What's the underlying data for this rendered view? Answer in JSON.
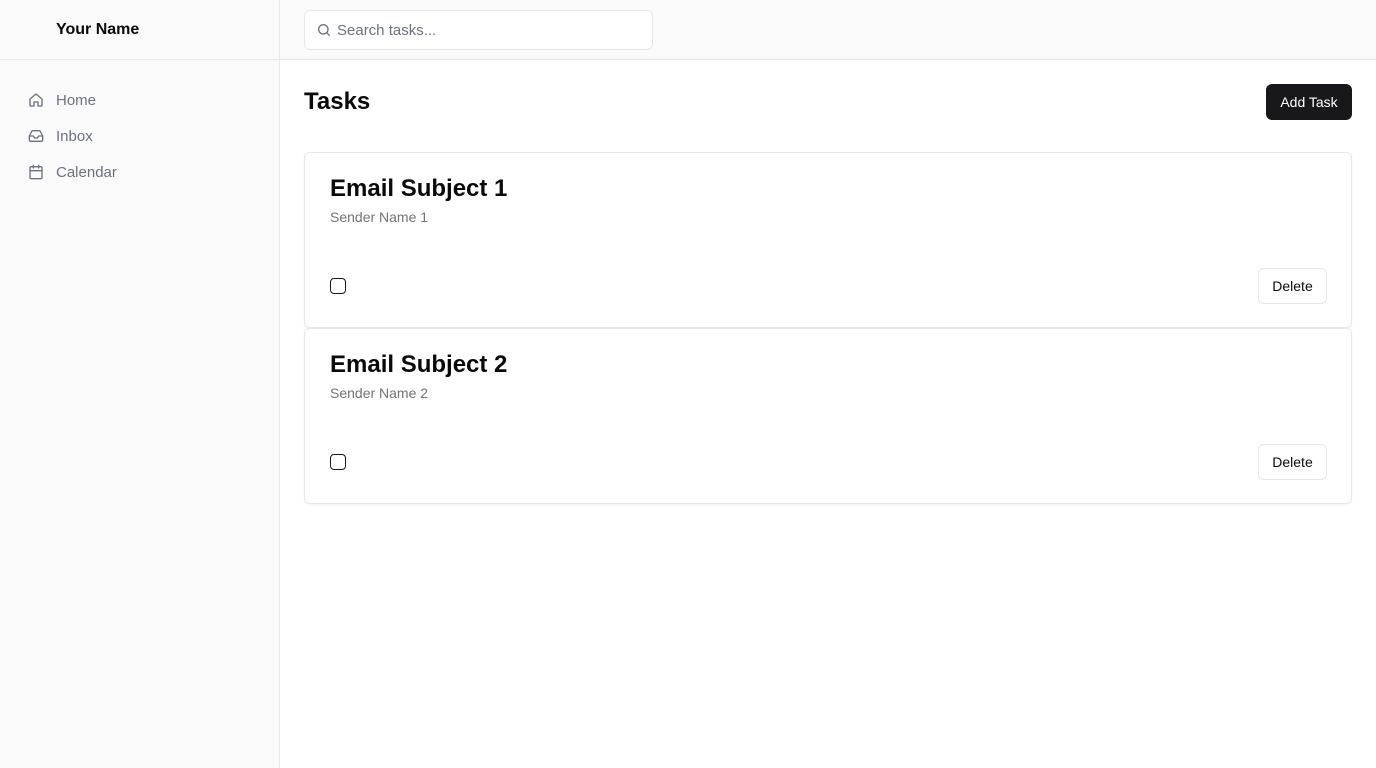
{
  "sidebar": {
    "user_name": "Your Name",
    "items": [
      {
        "label": "Home",
        "icon": "home-icon"
      },
      {
        "label": "Inbox",
        "icon": "inbox-icon"
      },
      {
        "label": "Calendar",
        "icon": "calendar-icon"
      }
    ]
  },
  "search": {
    "placeholder": "Search tasks...",
    "value": "",
    "icon": "search-icon"
  },
  "main": {
    "title": "Tasks",
    "add_button_label": "Add Task",
    "tasks": [
      {
        "subject": "Email Subject 1",
        "sender": "Sender Name 1",
        "checked": false,
        "delete_label": "Delete"
      },
      {
        "subject": "Email Subject 2",
        "sender": "Sender Name 2",
        "checked": false,
        "delete_label": "Delete"
      }
    ]
  },
  "colors": {
    "accent": "#18181b",
    "sidebar_bg": "#fafafa",
    "border": "#e5e7eb",
    "muted_text": "#6b7280"
  }
}
